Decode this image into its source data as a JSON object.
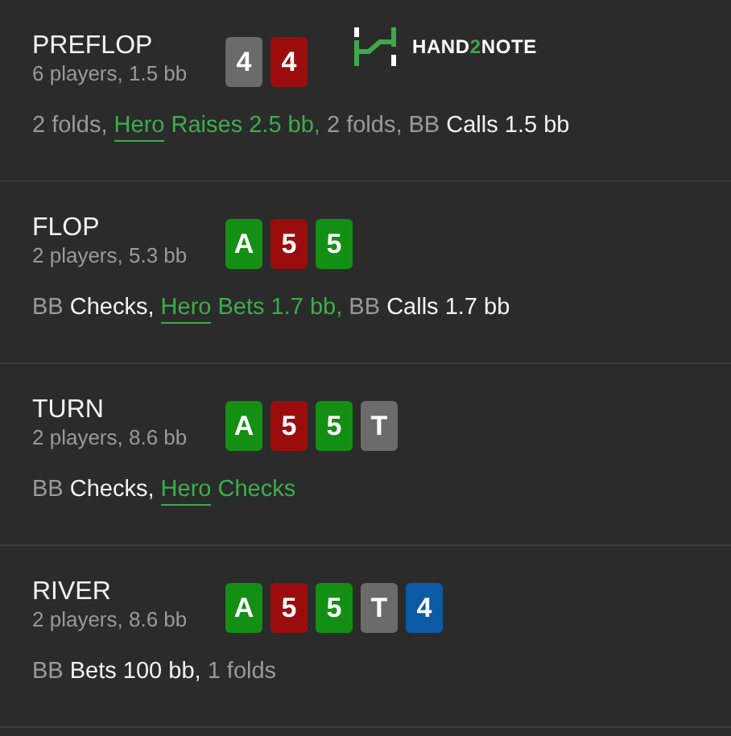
{
  "logo": {
    "parts": [
      {
        "text": "HAND",
        "accent": false
      },
      {
        "text": "2",
        "accent": true
      },
      {
        "text": "NOTE",
        "accent": false
      }
    ]
  },
  "streets": [
    {
      "name": "PREFLOP",
      "info": "6 players, 1.5 bb",
      "cards": [
        {
          "rank": "4",
          "color": "#6b6b6b"
        },
        {
          "rank": "4",
          "color": "#9b0d0d"
        }
      ],
      "actions": [
        {
          "text": "2 folds, ",
          "kind": "muted"
        },
        {
          "text": "Hero",
          "kind": "hero_link"
        },
        {
          "text": " Raises 2.5 bb,",
          "kind": "hero"
        },
        {
          "text": " 2 folds, BB ",
          "kind": "muted"
        },
        {
          "text": "Calls 1.5 bb",
          "kind": "plain"
        }
      ]
    },
    {
      "name": "FLOP",
      "info": "2 players, 5.3 bb",
      "cards": [
        {
          "rank": "A",
          "color": "#138f13"
        },
        {
          "rank": "5",
          "color": "#9b0d0d"
        },
        {
          "rank": "5",
          "color": "#138f13"
        }
      ],
      "actions": [
        {
          "text": "BB ",
          "kind": "muted"
        },
        {
          "text": "Checks, ",
          "kind": "plain"
        },
        {
          "text": "Hero",
          "kind": "hero_link"
        },
        {
          "text": " Bets 1.7 bb,",
          "kind": "hero"
        },
        {
          "text": " BB ",
          "kind": "muted"
        },
        {
          "text": "Calls 1.7 bb",
          "kind": "plain"
        }
      ]
    },
    {
      "name": "TURN",
      "info": "2 players, 8.6 bb",
      "cards": [
        {
          "rank": "A",
          "color": "#138f13"
        },
        {
          "rank": "5",
          "color": "#9b0d0d"
        },
        {
          "rank": "5",
          "color": "#138f13"
        },
        {
          "rank": "T",
          "color": "#6b6b6b"
        }
      ],
      "actions": [
        {
          "text": "BB ",
          "kind": "muted"
        },
        {
          "text": "Checks, ",
          "kind": "plain"
        },
        {
          "text": "Hero",
          "kind": "hero_link"
        },
        {
          "text": " Checks",
          "kind": "hero"
        }
      ]
    },
    {
      "name": "RIVER",
      "info": "2 players, 8.6 bb",
      "cards": [
        {
          "rank": "A",
          "color": "#138f13"
        },
        {
          "rank": "5",
          "color": "#9b0d0d"
        },
        {
          "rank": "5",
          "color": "#138f13"
        },
        {
          "rank": "T",
          "color": "#6b6b6b"
        },
        {
          "rank": "4",
          "color": "#0b5aa6"
        }
      ],
      "actions": [
        {
          "text": "BB ",
          "kind": "muted"
        },
        {
          "text": "Bets 100 bb,",
          "kind": "plain"
        },
        {
          "text": " 1 folds",
          "kind": "muted"
        }
      ]
    }
  ]
}
